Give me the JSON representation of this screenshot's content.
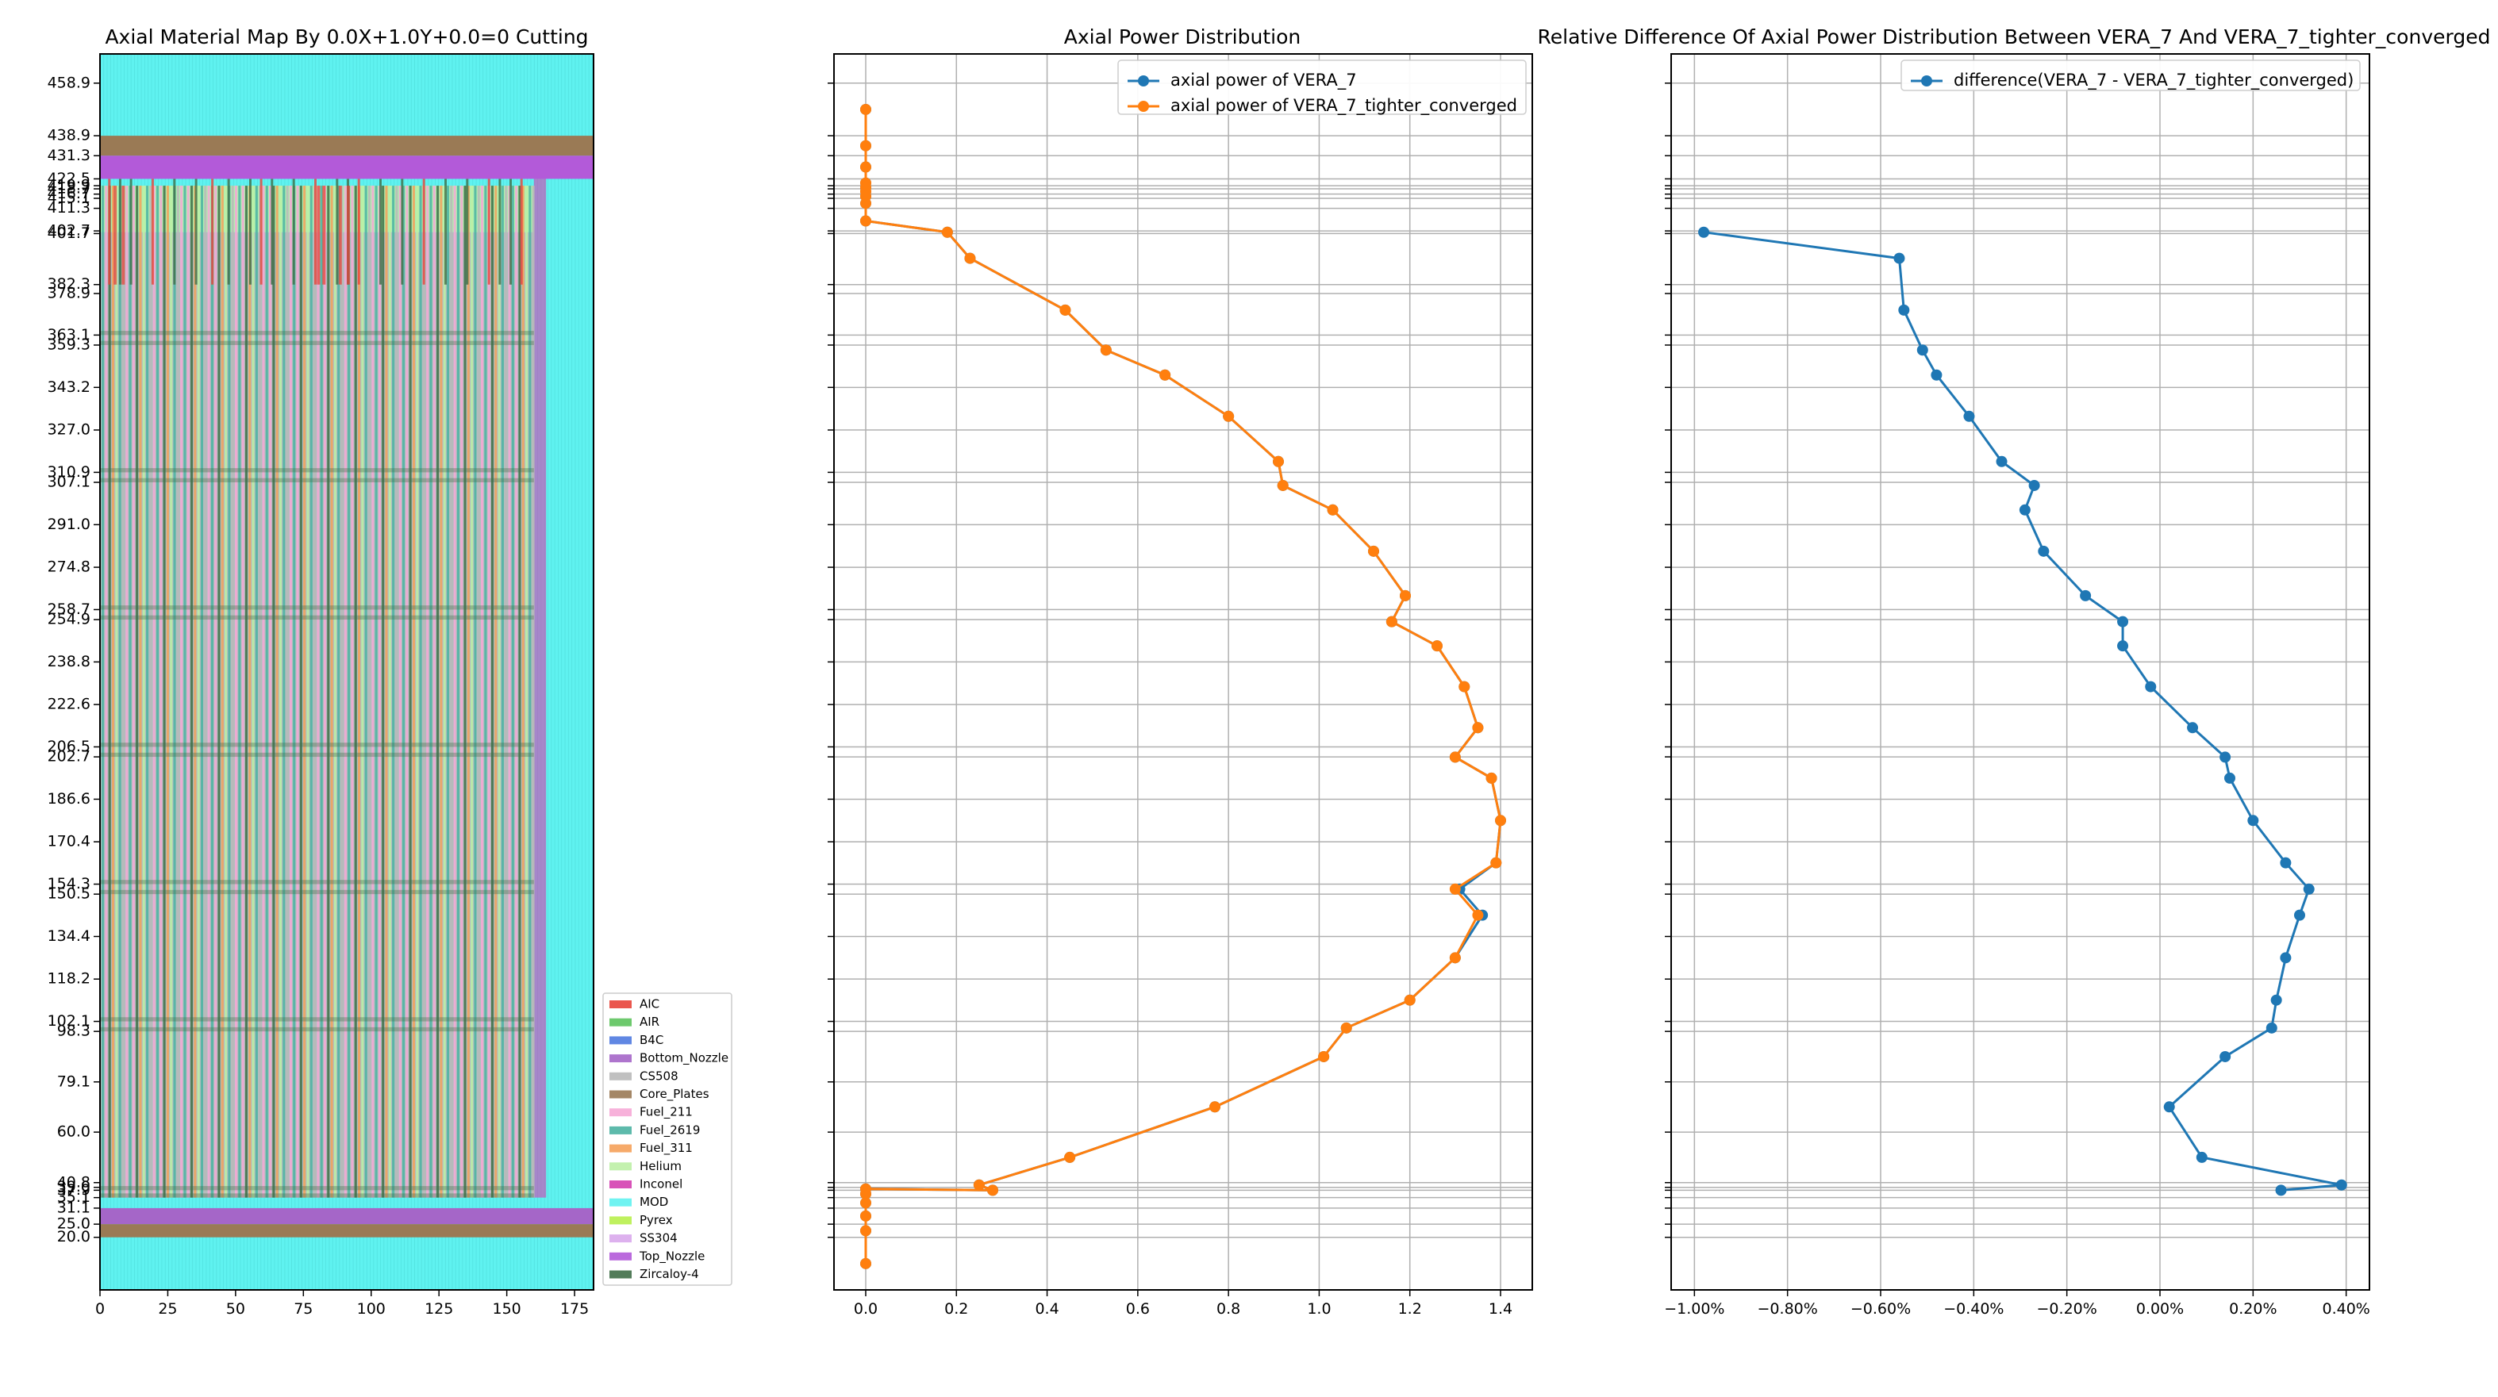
{
  "chart_data": [
    {
      "type": "heatmap",
      "title": "Axial Material Map By 0.0X+1.0Y+0.0=0 Cutting",
      "xlabel": "",
      "ylabel": "",
      "xlim": [
        0,
        182
      ],
      "ylim": [
        0,
        470
      ],
      "x_ticks": [
        0,
        25,
        50,
        75,
        100,
        125,
        150,
        175
      ],
      "y_tick_labels": [
        "20.0",
        "25.0",
        "31.1",
        "35.1",
        "37.9",
        "39.0",
        "40.8",
        "60.0",
        "79.1",
        "98.3",
        "102.1",
        "118.2",
        "134.4",
        "150.5",
        "154.3",
        "170.4",
        "186.6",
        "202.7",
        "206.5",
        "222.6",
        "238.8",
        "254.9",
        "258.7",
        "274.8",
        "291.0",
        "307.1",
        "310.9",
        "327.0",
        "343.2",
        "359.3",
        "363.1",
        "378.9",
        "382.3",
        "401.7",
        "402.7",
        "411.3",
        "415.1",
        "416.7",
        "418.7",
        "419.9",
        "422.5",
        "431.3",
        "438.9",
        "458.9"
      ],
      "legend": {
        "placement": "center-right",
        "entries": [
          {
            "name": "AIC",
            "color": "#e8443a"
          },
          {
            "name": "AIR",
            "color": "#5dc35d"
          },
          {
            "name": "B4C",
            "color": "#4f7ae0"
          },
          {
            "name": "Bottom_Nozzle",
            "color": "#a566c8"
          },
          {
            "name": "CS508",
            "color": "#b9b9b9"
          },
          {
            "name": "Core_Plates",
            "color": "#9a7a55"
          },
          {
            "name": "Fuel_211",
            "color": "#f6a8d6"
          },
          {
            "name": "Fuel_2619",
            "color": "#4bb3a2"
          },
          {
            "name": "Fuel_311",
            "color": "#f5a15a"
          },
          {
            "name": "Helium",
            "color": "#bdf0a5"
          },
          {
            "name": "Inconel",
            "color": "#d43fb0"
          },
          {
            "name": "MOD",
            "color": "#5ff2f0"
          },
          {
            "name": "Pyrex",
            "color": "#b8f04c"
          },
          {
            "name": "SS304",
            "color": "#d9a8ec"
          },
          {
            "name": "Top_Nozzle",
            "color": "#b35ad9"
          },
          {
            "name": "Zircaloy-4",
            "color": "#3f6e47"
          }
        ]
      }
    },
    {
      "type": "line",
      "title": "Axial Power Distribution",
      "xlabel": "",
      "ylabel": "",
      "xlim": [
        -0.07,
        1.47
      ],
      "x_ticks": [
        "0.0",
        "0.2",
        "0.4",
        "0.6",
        "0.8",
        "1.0",
        "1.2",
        "1.4"
      ],
      "grid": true,
      "legend_placement": "top-right",
      "series": [
        {
          "name": "axial power of VERA_7",
          "color": "#1f77b4",
          "points": [
            [
              0,
              448.9
            ],
            [
              0,
              435.1
            ],
            [
              0,
              427.0
            ],
            [
              0,
              420.9
            ],
            [
              0,
              419.3
            ],
            [
              0,
              417.7
            ],
            [
              0,
              415.9
            ],
            [
              0,
              413.2
            ],
            [
              0,
              406.5
            ],
            [
              0.18,
              402.2
            ],
            [
              0.23,
              392.3
            ],
            [
              0.44,
              372.6
            ],
            [
              0.53,
              357.4
            ],
            [
              0.66,
              347.9
            ],
            [
              0.8,
              332.2
            ],
            [
              0.91,
              315.0
            ],
            [
              0.92,
              305.9
            ],
            [
              1.03,
              296.6
            ],
            [
              1.12,
              280.9
            ],
            [
              1.19,
              264.0
            ],
            [
              1.16,
              254.1
            ],
            [
              1.26,
              244.9
            ],
            [
              1.32,
              229.4
            ],
            [
              1.35,
              213.8
            ],
            [
              1.3,
              202.6
            ],
            [
              1.38,
              194.6
            ],
            [
              1.4,
              178.5
            ],
            [
              1.39,
              162.4
            ],
            [
              1.31,
              152.4
            ],
            [
              1.36,
              142.5
            ],
            [
              1.3,
              126.3
            ],
            [
              1.2,
              110.2
            ],
            [
              1.06,
              99.6
            ],
            [
              1.01,
              88.7
            ],
            [
              0.77,
              69.6
            ],
            [
              0.45,
              50.4
            ],
            [
              0.25,
              39.9
            ],
            [
              0.28,
              37.9
            ],
            [
              0,
              38.4
            ],
            [
              0,
              36.5
            ],
            [
              0,
              33.1
            ],
            [
              0,
              28.1
            ],
            [
              0,
              22.5
            ],
            [
              0,
              10.0
            ]
          ]
        },
        {
          "name": "axial power of VERA_7_tighter_converged",
          "color": "#ff7f0e",
          "points": [
            [
              0,
              448.9
            ],
            [
              0,
              435.1
            ],
            [
              0,
              427.0
            ],
            [
              0,
              420.9
            ],
            [
              0,
              419.3
            ],
            [
              0,
              417.7
            ],
            [
              0,
              415.9
            ],
            [
              0,
              413.2
            ],
            [
              0,
              406.5
            ],
            [
              0.18,
              402.2
            ],
            [
              0.23,
              392.3
            ],
            [
              0.44,
              372.6
            ],
            [
              0.53,
              357.4
            ],
            [
              0.66,
              347.9
            ],
            [
              0.8,
              332.2
            ],
            [
              0.91,
              315.0
            ],
            [
              0.92,
              305.9
            ],
            [
              1.03,
              296.6
            ],
            [
              1.12,
              280.9
            ],
            [
              1.19,
              264.0
            ],
            [
              1.16,
              254.1
            ],
            [
              1.26,
              244.9
            ],
            [
              1.32,
              229.4
            ],
            [
              1.35,
              213.8
            ],
            [
              1.3,
              202.6
            ],
            [
              1.38,
              194.6
            ],
            [
              1.4,
              178.5
            ],
            [
              1.39,
              162.4
            ],
            [
              1.3,
              152.4
            ],
            [
              1.35,
              142.5
            ],
            [
              1.3,
              126.3
            ],
            [
              1.2,
              110.2
            ],
            [
              1.06,
              99.6
            ],
            [
              1.01,
              88.7
            ],
            [
              0.77,
              69.6
            ],
            [
              0.45,
              50.4
            ],
            [
              0.25,
              39.9
            ],
            [
              0.28,
              37.9
            ],
            [
              0,
              38.4
            ],
            [
              0,
              36.5
            ],
            [
              0,
              33.1
            ],
            [
              0,
              28.1
            ],
            [
              0,
              22.5
            ],
            [
              0,
              10.0
            ]
          ]
        }
      ]
    },
    {
      "type": "line",
      "title": "Relative Difference Of Axial Power Distribution Between VERA_7 And VERA_7_tighter_converged",
      "xlabel": "",
      "ylabel": "",
      "x_unit": "%",
      "xlim": [
        -1.05,
        0.45
      ],
      "x_ticks": [
        "−1.00%",
        "−0.80%",
        "−0.60%",
        "−0.40%",
        "−0.20%",
        "0.00%",
        "0.20%",
        "0.40%"
      ],
      "grid": true,
      "legend_placement": "top-right",
      "series": [
        {
          "name": "difference(VERA_7 - VERA_7_tighter_converged)",
          "color": "#1f77b4",
          "points": [
            [
              -0.98,
              402.2
            ],
            [
              -0.56,
              392.3
            ],
            [
              -0.55,
              372.6
            ],
            [
              -0.51,
              357.4
            ],
            [
              -0.48,
              347.9
            ],
            [
              -0.41,
              332.2
            ],
            [
              -0.34,
              315.0
            ],
            [
              -0.27,
              305.9
            ],
            [
              -0.29,
              296.6
            ],
            [
              -0.25,
              280.9
            ],
            [
              -0.16,
              264.0
            ],
            [
              -0.08,
              254.1
            ],
            [
              -0.08,
              244.9
            ],
            [
              -0.02,
              229.4
            ],
            [
              0.07,
              213.8
            ],
            [
              0.14,
              202.6
            ],
            [
              0.15,
              194.6
            ],
            [
              0.2,
              178.5
            ],
            [
              0.27,
              162.4
            ],
            [
              0.32,
              152.4
            ],
            [
              0.3,
              142.5
            ],
            [
              0.27,
              126.3
            ],
            [
              0.25,
              110.2
            ],
            [
              0.24,
              99.6
            ],
            [
              0.14,
              88.7
            ],
            [
              0.02,
              69.6
            ],
            [
              0.09,
              50.4
            ],
            [
              0.39,
              39.9
            ],
            [
              0.26,
              37.9
            ]
          ]
        }
      ]
    }
  ]
}
